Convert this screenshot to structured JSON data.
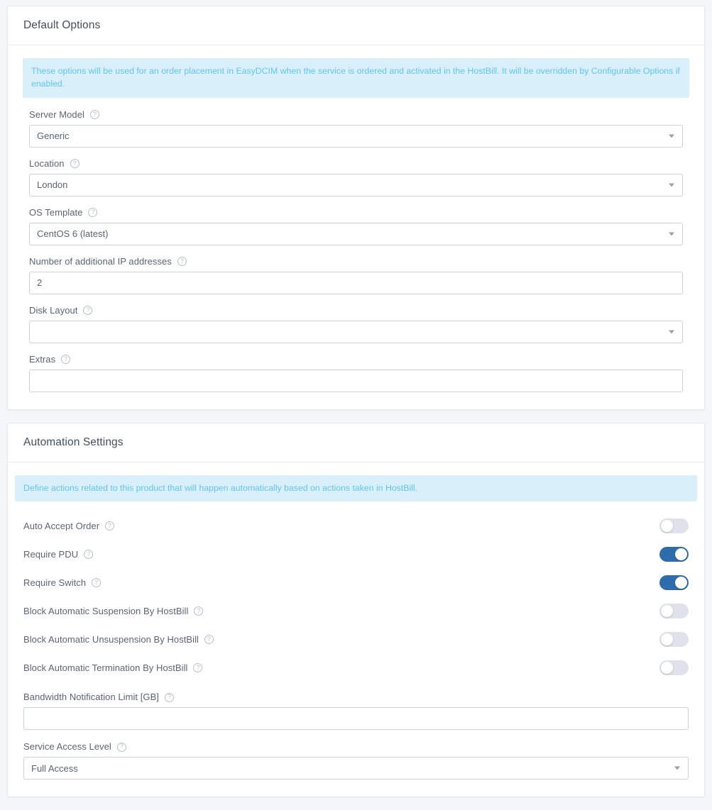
{
  "colors": {
    "accent_blue": "#2e6cab",
    "info_bg": "#d9f0fb",
    "info_text": "#63c3ee",
    "toggle_off": "#dfe2ea",
    "border": "#ccd1d8",
    "label_text": "#5b6572",
    "title_text": "#444e5e"
  },
  "help_icon_glyph": "?",
  "default_options": {
    "title": "Default Options",
    "info": "These options will be used for an order placement in EasyDCIM when the service is ordered and activated in the HostBill. It will be overridden by Configurable Options if enabled.",
    "fields": [
      {
        "label": "Server Model",
        "type": "select",
        "value": "Generic",
        "placeholder": ""
      },
      {
        "label": "Location",
        "type": "select",
        "value": "London",
        "placeholder": ""
      },
      {
        "label": "OS Template",
        "type": "select",
        "value": "CentOS 6 (latest)",
        "placeholder": ""
      },
      {
        "label": "Number of additional IP addresses",
        "type": "text",
        "value": "2",
        "placeholder": ""
      },
      {
        "label": "Disk Layout",
        "type": "select",
        "value": "",
        "placeholder": ""
      },
      {
        "label": "Extras",
        "type": "text",
        "value": "",
        "placeholder": ""
      }
    ]
  },
  "automation_settings": {
    "title": "Automation Settings",
    "info": "Define actions related to this product that will happen automatically based on actions taken in HostBill.",
    "toggles": [
      {
        "label": "Auto Accept Order",
        "state": "off"
      },
      {
        "label": "Require PDU",
        "state": "on"
      },
      {
        "label": "Require Switch",
        "state": "on"
      },
      {
        "label": "Block Automatic Suspension By HostBill",
        "state": "off"
      },
      {
        "label": "Block Automatic Unsuspension By HostBill",
        "state": "off"
      },
      {
        "label": "Block Automatic Termination By HostBill",
        "state": "off"
      }
    ],
    "fields": [
      {
        "label": "Bandwidth Notification Limit [GB]",
        "type": "text",
        "value": "",
        "placeholder": ""
      },
      {
        "label": "Service Access Level",
        "type": "select",
        "value": "Full Access",
        "placeholder": ""
      }
    ]
  }
}
